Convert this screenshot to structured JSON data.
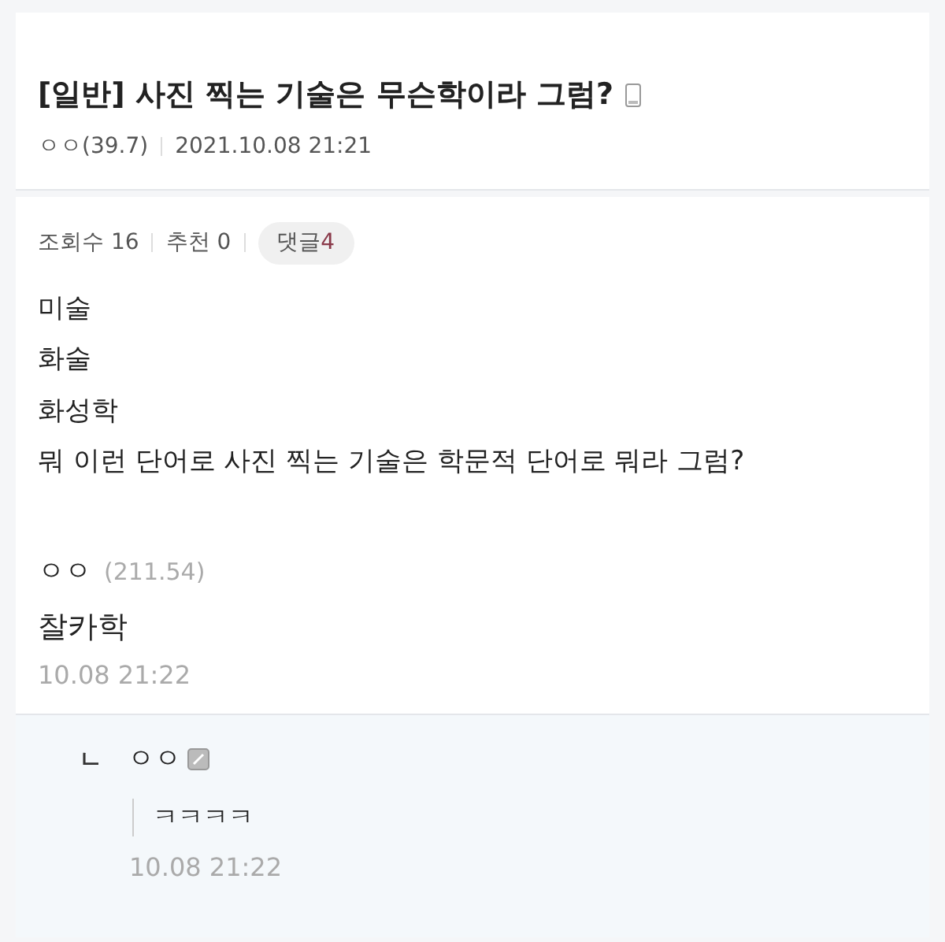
{
  "post": {
    "title": "[일반] 사진 찍는 기술은 무슨학이라 그럼?",
    "author": "ㅇㅇ(39.7)",
    "date": "2021.10.08 21:21"
  },
  "stats": {
    "views": "조회수 16",
    "recommends": "추천 0",
    "comments_label": "댓글",
    "comments_count": "4"
  },
  "body": [
    "미술",
    "화술",
    "화성학",
    "뭐 이런 단어로 사진 찍는 기술은 학문적 단어로 뭐라 그럼?"
  ],
  "comments": [
    {
      "kind": "comment",
      "author": "ㅇㅇ",
      "ip": "(211.54)",
      "text": "찰카학",
      "date": "10.08 21:22"
    },
    {
      "kind": "reply",
      "marker": "ㄴ",
      "author": "ㅇㅇ",
      "text": "ㅋㅋㅋㅋ",
      "date": "10.08 21:22"
    }
  ]
}
